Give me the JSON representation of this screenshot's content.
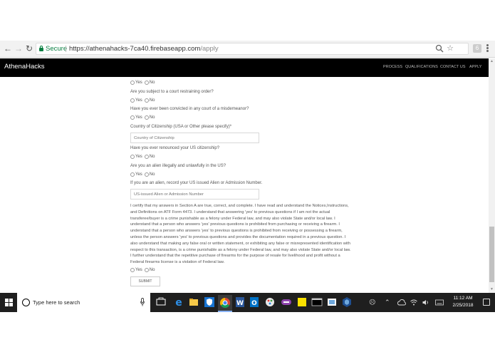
{
  "browser": {
    "secure_label": "Secure",
    "url_host": "https://athenahacks-7ca40.firebaseapp.com",
    "url_path": "/apply",
    "extension_label": "6"
  },
  "navbar": {
    "brand": "AthenaHacks",
    "links": [
      "PROCESS",
      "QUALIFICATIONS",
      "CONTACT US",
      "APPLY"
    ]
  },
  "form": {
    "yes_label": "Yes",
    "no_label": "No",
    "questions": {
      "restraining": "Are you subject to a court restraining order?",
      "misdemeanor": "Have you ever been convicted in any court of a misdemeanor?",
      "citizenship": "Country of Citizenship (USA or Other please specify)*",
      "renounced": "Have you ever renounced your US citizenship?",
      "alien": "Are you an alien illegally and unlawfully in the US?",
      "alien_number": "If you are an alien, record your US issued Alien or Admission Number."
    },
    "citizenship_placeholder": "Country of Citizenship",
    "alien_number_placeholder": "US-issued Alien or Admission Number",
    "certification_lines": [
      "I certify that my answers in Section A are true, correct, and complete. I have read and understand the Notices,Instructions,",
      "and Definitions on ATF Form 4473. I understand that answering 'yes' to previous questions if I am not the actual",
      "transferee/buyer is a crime punishable as a felony under Federal law, and may also violate State and/or local law. I",
      "understand that a person who answers 'yes' previous questions is prohibited from purchasing or receiving a firearm. I",
      "understand that a person who answers 'yes' to previous questions is prohibited from receiving or possessing a firearm,",
      "unless the person answers 'yes' to previous questions and provides the documentation required in a previous question. I",
      "also understand that making any false oral or written statement, or exhibiting any false or misrepresented identification with",
      "respect to this transaction, is a crime punishable as a felony under Federal law, and may also violate State and/or local law.",
      "I further understand that the repetitive purchase of firearms for the purpose of resale for livelihood and profit without a",
      "Federal firearms license is a violation of Federal law."
    ],
    "submit_label": "SUBMIT"
  },
  "taskbar": {
    "search_placeholder": "Type here to search",
    "time": "11:12 AM",
    "date": "2/25/2018"
  },
  "colors": {
    "navbar_bg": "#000000",
    "secure_green": "#0b8043",
    "taskbar_bg": "#1f1f1f"
  }
}
